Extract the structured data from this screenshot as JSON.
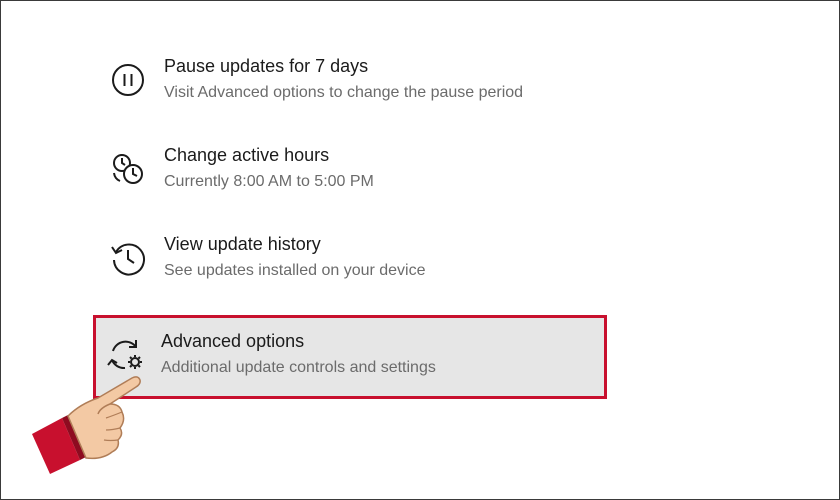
{
  "settings_items": [
    {
      "title": "Pause updates for 7 days",
      "subtitle": "Visit Advanced options to change the pause period",
      "icon": "pause-icon"
    },
    {
      "title": "Change active hours",
      "subtitle": "Currently 8:00 AM to 5:00 PM",
      "icon": "active-hours-icon"
    },
    {
      "title": "View update history",
      "subtitle": "See updates installed on your device",
      "icon": "history-icon"
    },
    {
      "title": "Advanced options",
      "subtitle": "Additional update controls and settings",
      "icon": "advanced-options-icon"
    }
  ],
  "colors": {
    "highlight_border": "#c8102e",
    "highlight_background": "#e6e6e6",
    "title_text": "#1b1b1b",
    "subtitle_text": "#6b6b6b"
  },
  "pointer_icon": "pointing-hand-icon"
}
